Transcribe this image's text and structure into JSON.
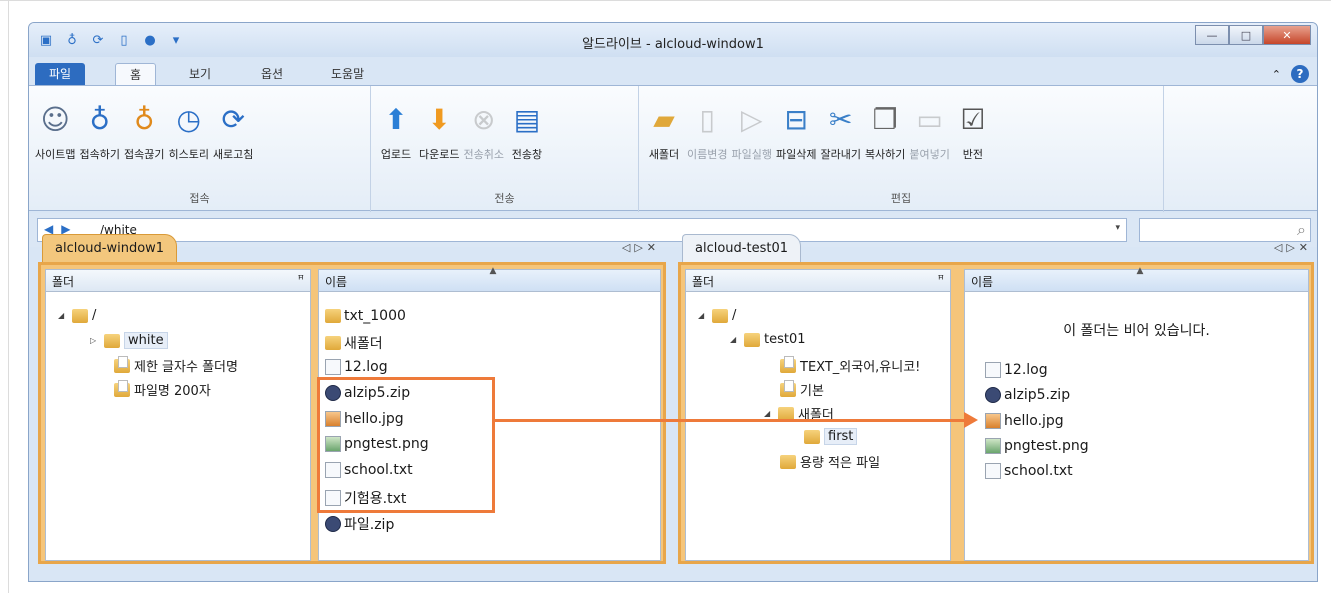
{
  "window": {
    "title": "알드라이브 - alcloud-window1",
    "controls": [
      "—",
      "□",
      "✕"
    ]
  },
  "quick_access": [
    "app-icon",
    "connect-icon",
    "refresh-icon",
    "page-icon",
    "sync-icon",
    "dropdown-icon"
  ],
  "ribbon_tabs": {
    "file": "파일",
    "home": "홈",
    "view": "보기",
    "options": "옵션",
    "help": "도움말"
  },
  "ribbon": {
    "connect_group": {
      "label": "접속",
      "buttons": [
        "사이트맵",
        "접속하기",
        "접속끊기",
        "히스토리",
        "새로고침"
      ]
    },
    "transfer_group": {
      "label": "전송",
      "buttons": [
        "업로드",
        "다운로드",
        "전송취소",
        "전송창"
      ]
    },
    "edit_group": {
      "label": "편집",
      "buttons": [
        "새폴더",
        "이름변경",
        "파일실행",
        "파일삭제",
        "잘라내기",
        "복사하기",
        "붙여넣기",
        "반전"
      ]
    }
  },
  "address": {
    "path": "/white",
    "search_placeholder": ""
  },
  "left_pane": {
    "tab": "alcloud-window1",
    "folder_header": "폴더",
    "name_header": "이름",
    "tree": [
      "/",
      "white",
      "제한 글자수 폴더명",
      "파일명 200자"
    ],
    "files": [
      "txt_1000",
      "새폴더",
      "12.log",
      "alzip5.zip",
      "hello.jpg",
      "pngtest.png",
      "school.txt",
      "기험용.txt",
      "파일.zip"
    ]
  },
  "right_pane": {
    "tab": "alcloud-test01",
    "folder_header": "폴더",
    "name_header": "이름",
    "tree": [
      "/",
      "test01",
      "TEXT_외국어,유니코!",
      "기본",
      "새폴더",
      "first",
      "용량 적은 파일"
    ],
    "empty_message": "이 폴더는 비어 있습니다.",
    "files": [
      "12.log",
      "alzip5.zip",
      "hello.jpg",
      "pngtest.png",
      "school.txt"
    ]
  },
  "colors": {
    "accent_orange": "#ee7a3a",
    "pane_orange": "#f5c57a",
    "file_tab_blue": "#2d6cc0"
  }
}
